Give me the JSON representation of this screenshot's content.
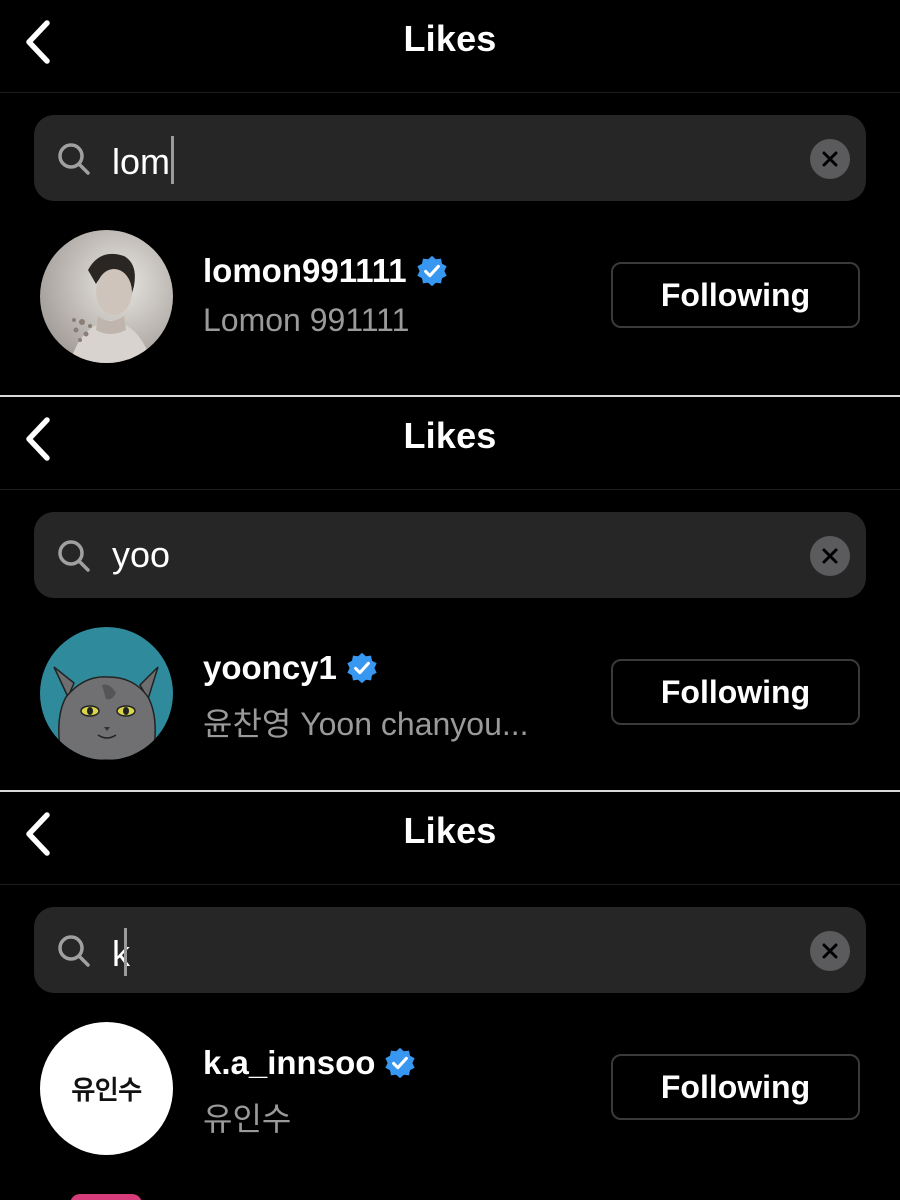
{
  "panels": [
    {
      "nav": {
        "title": "Likes",
        "back_icon": "chevron-left-icon"
      },
      "search": {
        "query": "lom",
        "search_icon": "search-icon",
        "clear_icon": "clear-x-icon"
      },
      "result": {
        "username": "lomon991111",
        "full_name": "Lomon 991111",
        "verified": true,
        "follow_label": "Following",
        "avatar": "profile-photo"
      }
    },
    {
      "nav": {
        "title": "Likes",
        "back_icon": "chevron-left-icon"
      },
      "search": {
        "query": "yoo",
        "search_icon": "search-icon",
        "clear_icon": "clear-x-icon"
      },
      "result": {
        "username": "yooncy1",
        "full_name": "윤찬영 Yoon chanyou...",
        "verified": true,
        "follow_label": "Following",
        "avatar": "cat-illustration"
      }
    },
    {
      "nav": {
        "title": "Likes",
        "back_icon": "chevron-left-icon"
      },
      "search": {
        "query": "k",
        "search_icon": "search-icon",
        "clear_icon": "clear-x-icon"
      },
      "result": {
        "username": "k.a_innsoo",
        "full_name": "유인수",
        "avatar_text": "유인수",
        "verified": true,
        "follow_label": "Following",
        "avatar": "name-avatar"
      }
    }
  ],
  "colors": {
    "background": "#000000",
    "search_bg": "#262626",
    "secondary_text": "#9a9a9a",
    "verified_blue": "#3897f0",
    "button_border": "#3a3a3c"
  }
}
